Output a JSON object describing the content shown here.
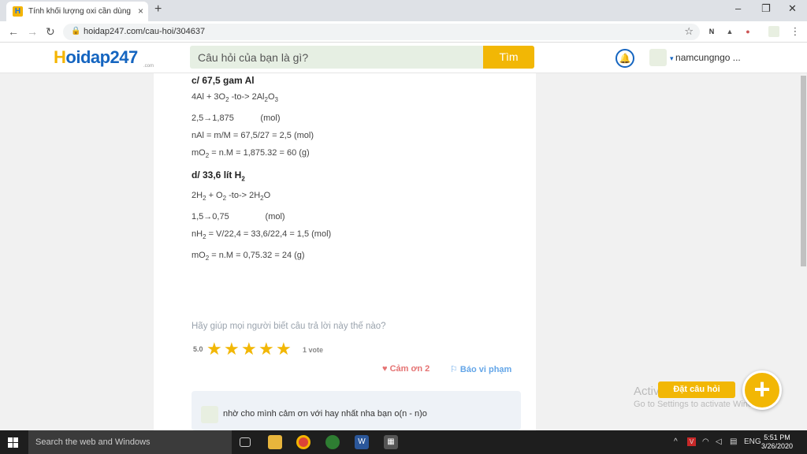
{
  "browser": {
    "tab_title": "Tính khối lượng oxi cần dùng để",
    "tab_close": "×",
    "new_tab": "+",
    "url": "hoidap247.com/cau-hoi/304637",
    "win_min": "–",
    "win_max": "❐",
    "win_close": "✕"
  },
  "site": {
    "logo": "oidap247",
    "logo_h": "H",
    "logo_sub": ".com",
    "search_placeholder": "Câu hỏi của bạn là gì?",
    "search_button": "Tìm",
    "username": "namcungngo ..."
  },
  "answer": {
    "c_title": "c/ 67,5 gam Al",
    "c_eq": [
      "4Al + 3O",
      "2",
      " -to-> 2Al",
      "2",
      "O",
      "3"
    ],
    "c_mol": "2,5→1,875           (mol)",
    "c_nal": "nAl = m/M = 67,5/27 = 2,5 (mol)",
    "c_mo2": [
      "mO",
      "2",
      " = n.M = 1,875.32 = 60 (g)"
    ],
    "d_title": [
      "d/ 33,6 lít H",
      "2"
    ],
    "d_eq": [
      "2H",
      "2",
      " + O",
      "2",
      " -to-> 2H",
      "2",
      "O"
    ],
    "d_mol": "1,5→0,75               (mol)",
    "d_nh2": [
      "nH",
      "2",
      " = V/22,4 = 33,6/22,4 = 1,5 (mol)"
    ],
    "d_mo2": [
      "mO",
      "2",
      " = n.M = 0,75.32 = 24 (g)"
    ]
  },
  "feedback": {
    "help_text": "Hãy giúp mọi người biết câu trả lời này thế nào?",
    "rating": "5.0",
    "stars": 5,
    "votes": "1 vote",
    "thanks": "Cảm ơn 2",
    "report": "Báo vi phạm"
  },
  "comment": {
    "text": "nhờ cho mình cảm ơn với hay nhất nha bạn o(n - n)o"
  },
  "overlay": {
    "activate_line1": "Activ",
    "activate_line2": "Go to Settings to activate Windows.",
    "ask_button": "Đặt câu hỏi",
    "plus": "+"
  },
  "taskbar": {
    "search": "Search the web and Windows",
    "lang": "ENG",
    "time": "5:51 PM",
    "date": "3/26/2020"
  }
}
